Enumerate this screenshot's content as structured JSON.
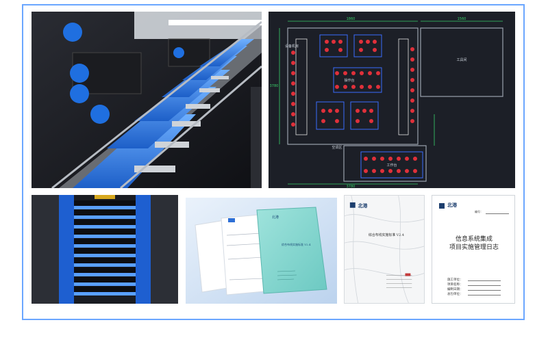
{
  "images": {
    "cabling_tray": {
      "alt": ""
    },
    "floor_plan": {
      "alt": "",
      "dims": {
        "top_left": "1860",
        "top_right": "1560",
        "left": "3780",
        "bottom": "3780"
      },
      "labels": {
        "room_left": "设备机房",
        "center": "操作台",
        "right_room": "工具间",
        "lower_left": "空调区",
        "lower_box": "工作台"
      }
    },
    "rack_patch": {
      "alt": ""
    },
    "manual_docs": {
      "alt": "",
      "cover_logo": "北港",
      "cover_title": "综合布线实施标准 V2.4"
    },
    "doc_marble": {
      "alt": "",
      "logo": "北港",
      "title": "综合布线实施标准 V2.4"
    },
    "doc_journal": {
      "alt": "",
      "logo": "北港",
      "no_label": "编号：",
      "title_line1": "信息系统集成",
      "title_line2": "项目实施管理日志",
      "fields": [
        "施工单位：",
        "项目名称：",
        "编制日期：",
        "总包单位："
      ]
    }
  },
  "caption": {
    "text": ""
  },
  "colors": {
    "frame": "#6aa6ff",
    "caption": "#2f6fdc"
  }
}
